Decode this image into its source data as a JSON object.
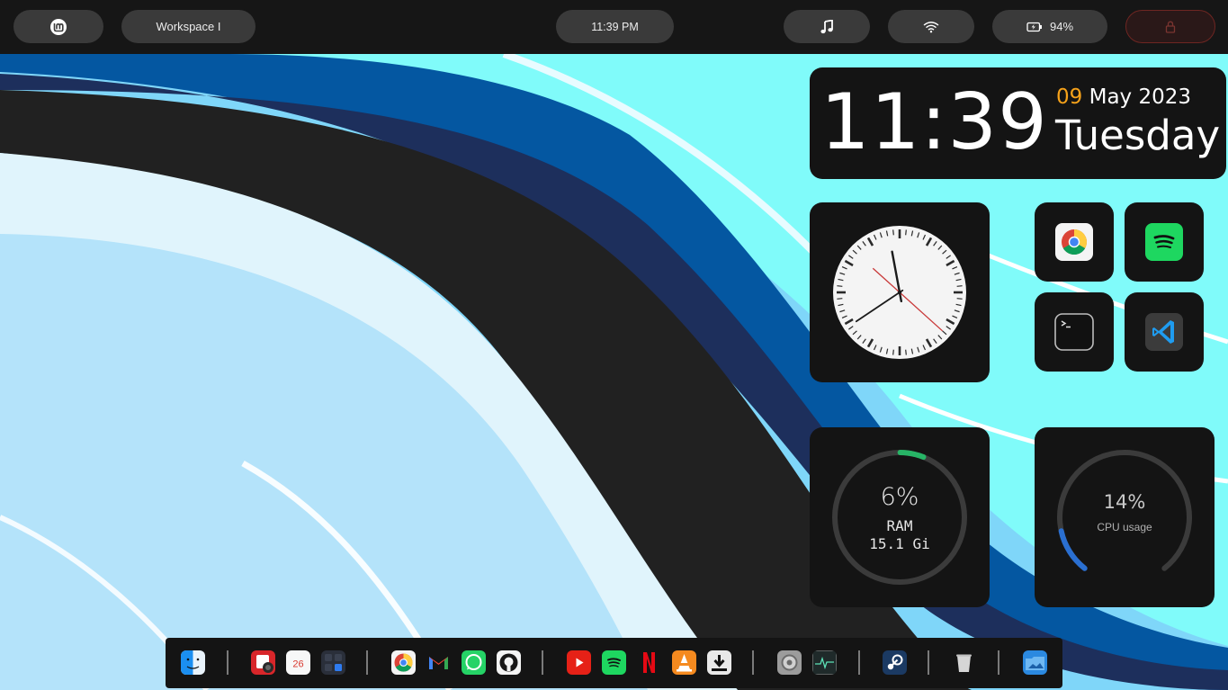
{
  "topbar": {
    "workspace_label": "Workspace I",
    "clock": "11:39 PM",
    "battery_percent": "94%",
    "icons": [
      "linux-mint-logo",
      "music-note-icon",
      "wifi-icon",
      "battery-charging-icon",
      "lock-icon"
    ]
  },
  "date_widget": {
    "time": "11:39",
    "day": "09",
    "month_year": "May 2023",
    "weekday": "Tuesday",
    "accent_color": "#f6a21a"
  },
  "analog_clock": {
    "hours": 11,
    "minutes": 39,
    "seconds": 22
  },
  "app_shortcuts": [
    "Chrome",
    "Spotify",
    "Terminal",
    "Visual Studio Code"
  ],
  "ram_widget": {
    "percent_label": "6%",
    "label": "RAM",
    "value": "15.1 Gi",
    "usage_fraction": 0.06,
    "accent_color": "#27b466"
  },
  "cpu_widget": {
    "percent_label": "14%",
    "label": "CPU usage",
    "usage_fraction": 0.14,
    "accent_color": "#2a6fd1"
  },
  "dock": {
    "groups": [
      [
        "finder"
      ],
      [
        "photo-booth",
        "calendar",
        "calculator"
      ],
      [
        "chrome",
        "gmail",
        "whatsapp",
        "github"
      ],
      [
        "youtube",
        "spotify",
        "netflix",
        "vlc",
        "downloader"
      ],
      [
        "system-settings",
        "activity-monitor"
      ],
      [
        "steam"
      ],
      [
        "trash"
      ],
      [
        "home-folder"
      ]
    ],
    "calendar_day": "26"
  }
}
